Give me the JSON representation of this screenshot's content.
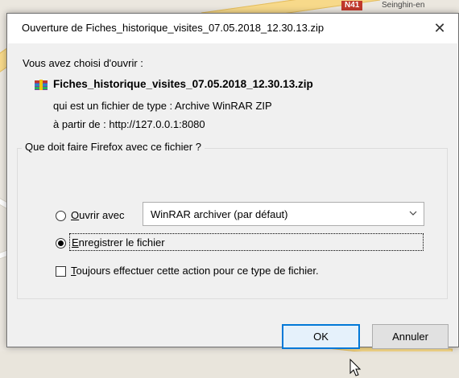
{
  "background": {
    "road_sign": "N41",
    "place_label": "Seinghin-en"
  },
  "dialog": {
    "title": "Ouverture de Fiches_historique_visites_07.05.2018_12.30.13.zip",
    "close_glyph": "✕",
    "intro": "Vous avez choisi d'ouvrir :",
    "file": {
      "icon": "winrar-archive-icon",
      "name": "Fiches_historique_visites_07.05.2018_12.30.13.zip",
      "type_line": "qui est un fichier de type : Archive WinRAR ZIP",
      "source_line": "à partir de : http://127.0.0.1:8080"
    },
    "group_legend": "Que doit faire Firefox avec ce fichier ?",
    "options": {
      "open_with": {
        "key": "O",
        "rest": "uvrir avec",
        "selected": false,
        "app_select_value": "WinRAR archiver (par défaut)"
      },
      "save": {
        "key": "E",
        "rest": "nregistrer le fichier",
        "selected": true
      },
      "always": {
        "key": "T",
        "rest": "oujours effectuer cette action pour ce type de fichier.",
        "checked": false
      }
    },
    "buttons": {
      "ok": "OK",
      "cancel": "Annuler"
    },
    "colors": {
      "focus_border": "#0078d7",
      "dialog_bg": "#f0f0f0"
    }
  }
}
